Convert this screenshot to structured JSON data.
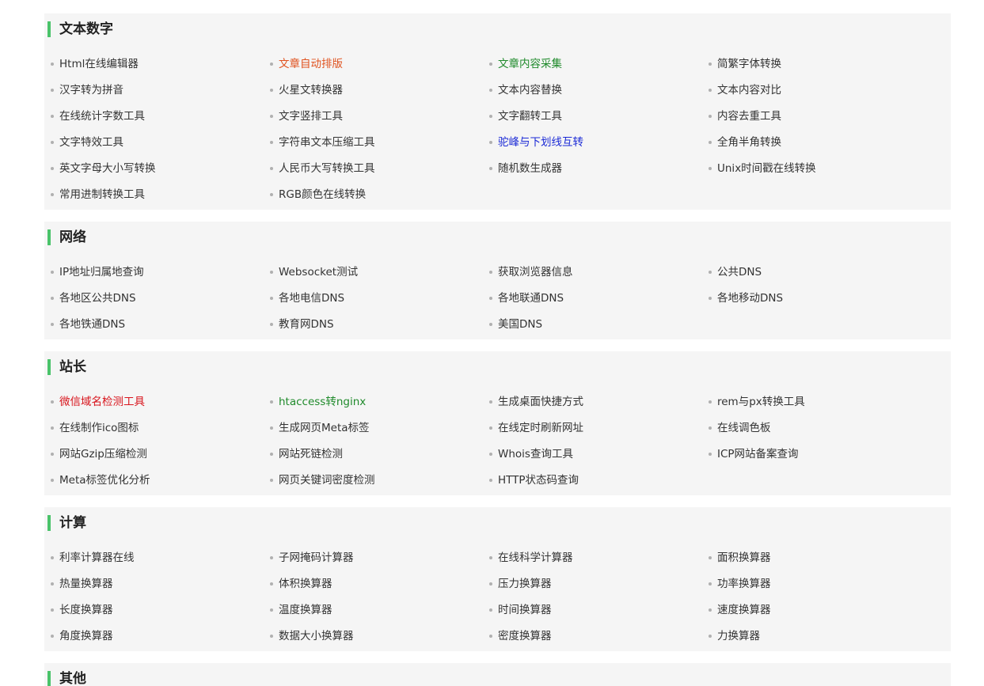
{
  "colors": {
    "accent_bar": "#4ac36a",
    "text_default": "#333333",
    "text_orange": "#e0521f",
    "text_green": "#1f8a2b",
    "text_blue": "#1c2bd6",
    "text_red": "#d8141c"
  },
  "sections": [
    {
      "title": "文本数字",
      "items": [
        {
          "label": "Html在线编辑器",
          "color": "default"
        },
        {
          "label": " 文章自动排版",
          "color": "orange"
        },
        {
          "label": " 文章内容采集",
          "color": "green"
        },
        {
          "label": "简繁字体转换",
          "color": "default"
        },
        {
          "label": "汉字转为拼音",
          "color": "default"
        },
        {
          "label": "火星文转换器",
          "color": "default"
        },
        {
          "label": "文本内容替换",
          "color": "default"
        },
        {
          "label": " 文本内容对比",
          "color": "default"
        },
        {
          "label": "在线统计字数工具",
          "color": "default"
        },
        {
          "label": "文字竖排工具",
          "color": "default"
        },
        {
          "label": "文字翻转工具",
          "color": "default"
        },
        {
          "label": "内容去重工具",
          "color": "default"
        },
        {
          "label": "文字特效工具",
          "color": "default"
        },
        {
          "label": "字符串文本压缩工具",
          "color": "default"
        },
        {
          "label": "驼峰与下划线互转",
          "color": "blue"
        },
        {
          "label": "全角半角转换",
          "color": "default"
        },
        {
          "label": "英文字母大小写转换",
          "color": "default"
        },
        {
          "label": "人民币大写转换工具",
          "color": "default"
        },
        {
          "label": "随机数生成器",
          "color": "default"
        },
        {
          "label": " Unix时间戳在线转换",
          "color": "default"
        },
        {
          "label": "常用进制转换工具",
          "color": "default"
        },
        {
          "label": " RGB颜色在线转换",
          "color": "default"
        }
      ]
    },
    {
      "title": "网络",
      "items": [
        {
          "label": "IP地址归属地查询",
          "color": "default"
        },
        {
          "label": "Websocket测试",
          "color": "default"
        },
        {
          "label": "获取浏览器信息",
          "color": "default"
        },
        {
          "label": "公共DNS",
          "color": "default"
        },
        {
          "label": "各地区公共DNS",
          "color": "default"
        },
        {
          "label": "各地电信DNS",
          "color": "default"
        },
        {
          "label": "各地联通DNS",
          "color": "default"
        },
        {
          "label": "各地移动DNS",
          "color": "default"
        },
        {
          "label": "各地铁通DNS",
          "color": "default"
        },
        {
          "label": "教育网DNS",
          "color": "default"
        },
        {
          "label": "美国DNS",
          "color": "default"
        }
      ]
    },
    {
      "title": "站长",
      "items": [
        {
          "label": "微信域名检测工具",
          "color": "red"
        },
        {
          "label": "htaccess转nginx",
          "color": "green"
        },
        {
          "label": "生成桌面快捷方式",
          "color": "default"
        },
        {
          "label": "rem与px转换工具",
          "color": "default"
        },
        {
          "label": "在线制作ico图标",
          "color": "default"
        },
        {
          "label": "生成网页Meta标签",
          "color": "default"
        },
        {
          "label": "在线定时刷新网址",
          "color": "default"
        },
        {
          "label": "在线调色板",
          "color": "default"
        },
        {
          "label": "网站Gzip压缩检测",
          "color": "default"
        },
        {
          "label": "网站死链检测",
          "color": "default"
        },
        {
          "label": " Whois查询工具",
          "color": "default"
        },
        {
          "label": "ICP网站备案查询",
          "color": "default"
        },
        {
          "label": "Meta标签优化分析",
          "color": "default"
        },
        {
          "label": "网页关键词密度检测",
          "color": "default"
        },
        {
          "label": "HTTP状态码查询",
          "color": "default"
        }
      ]
    },
    {
      "title": "计算",
      "items": [
        {
          "label": "利率计算器在线",
          "color": "default"
        },
        {
          "label": "子网掩码计算器",
          "color": "default"
        },
        {
          "label": "在线科学计算器",
          "color": "default"
        },
        {
          "label": "面积换算器",
          "color": "default"
        },
        {
          "label": "热量换算器",
          "color": "default"
        },
        {
          "label": "体积换算器",
          "color": "default"
        },
        {
          "label": "压力换算器",
          "color": "default"
        },
        {
          "label": "功率换算器",
          "color": "default"
        },
        {
          "label": "长度换算器",
          "color": "default"
        },
        {
          "label": "温度换算器",
          "color": "default"
        },
        {
          "label": "时间换算器",
          "color": "default"
        },
        {
          "label": "速度换算器",
          "color": "default"
        },
        {
          "label": "角度换算器",
          "color": "default"
        },
        {
          "label": "数据大小换算器",
          "color": "default"
        },
        {
          "label": "密度换算器",
          "color": "default"
        },
        {
          "label": "力换算器",
          "color": "default"
        }
      ]
    },
    {
      "title": "其他",
      "items": []
    }
  ]
}
